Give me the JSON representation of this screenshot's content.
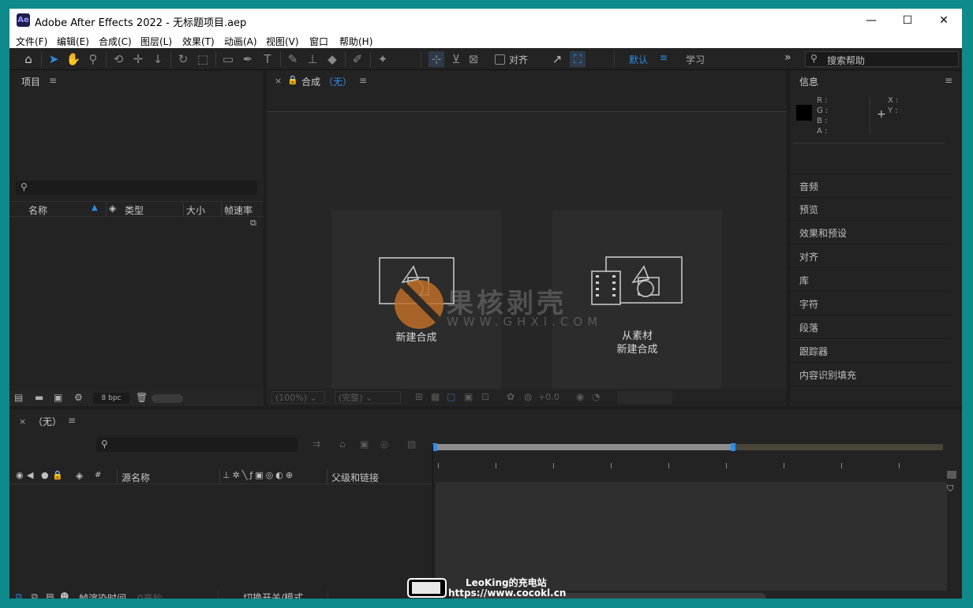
{
  "window": {
    "app_icon": "Ae",
    "title": "Adobe After Effects 2022 - 无标题项目.aep",
    "controls": {
      "minimize": "—",
      "maximize": "☐",
      "close": "✕"
    }
  },
  "menubar": [
    "文件(F)",
    "编辑(E)",
    "合成(C)",
    "图层(L)",
    "效果(T)",
    "动画(A)",
    "视图(V)",
    "窗口",
    "帮助(H)"
  ],
  "toolbar": {
    "align_label": "对齐",
    "workspace_default": "默认",
    "workspace_learn": "学习",
    "search_help_placeholder": "搜索帮助"
  },
  "project_panel": {
    "title": "项目",
    "columns": [
      "名称",
      "类型",
      "大小",
      "帧速率"
    ],
    "bpc": "8 bpc"
  },
  "composition_panel": {
    "tab_title": "合成",
    "tab_comp": "（无）",
    "new_comp": "新建合成",
    "from_footage_line1": "从素材",
    "from_footage_line2": "新建合成",
    "zoom": "(100%)",
    "resolution": "(完整)",
    "exposure": "+0.0"
  },
  "info_panel": {
    "title": "信息",
    "channels": [
      "R :",
      "G :",
      "B :",
      "A :"
    ],
    "coords": [
      "X :",
      "Y :"
    ]
  },
  "right_panels": [
    "音频",
    "预览",
    "效果和预设",
    "对齐",
    "库",
    "字符",
    "段落",
    "跟踪器",
    "内容识别填充"
  ],
  "timeline": {
    "tab_close": "×",
    "tab_title": "（无）",
    "columns": {
      "number": "#",
      "source_name": "源名称",
      "parent": "父级和链接"
    },
    "footer_render_label": "帧渲染时间",
    "footer_render_value": "0毫秒",
    "footer_toggle": "切换开关/模式"
  },
  "watermark": {
    "cn": "果核剥壳",
    "url": "WWW.GHXI.COM"
  },
  "overlay_badge": {
    "line1": "LeoKing的充电站",
    "line2": "https://www.cocokl.cn"
  },
  "colors": {
    "accent_blue": "#2d8ceb",
    "title_bg": "#ffffff",
    "panel_bg": "#232323",
    "border_teal": "#0e8a8c"
  }
}
